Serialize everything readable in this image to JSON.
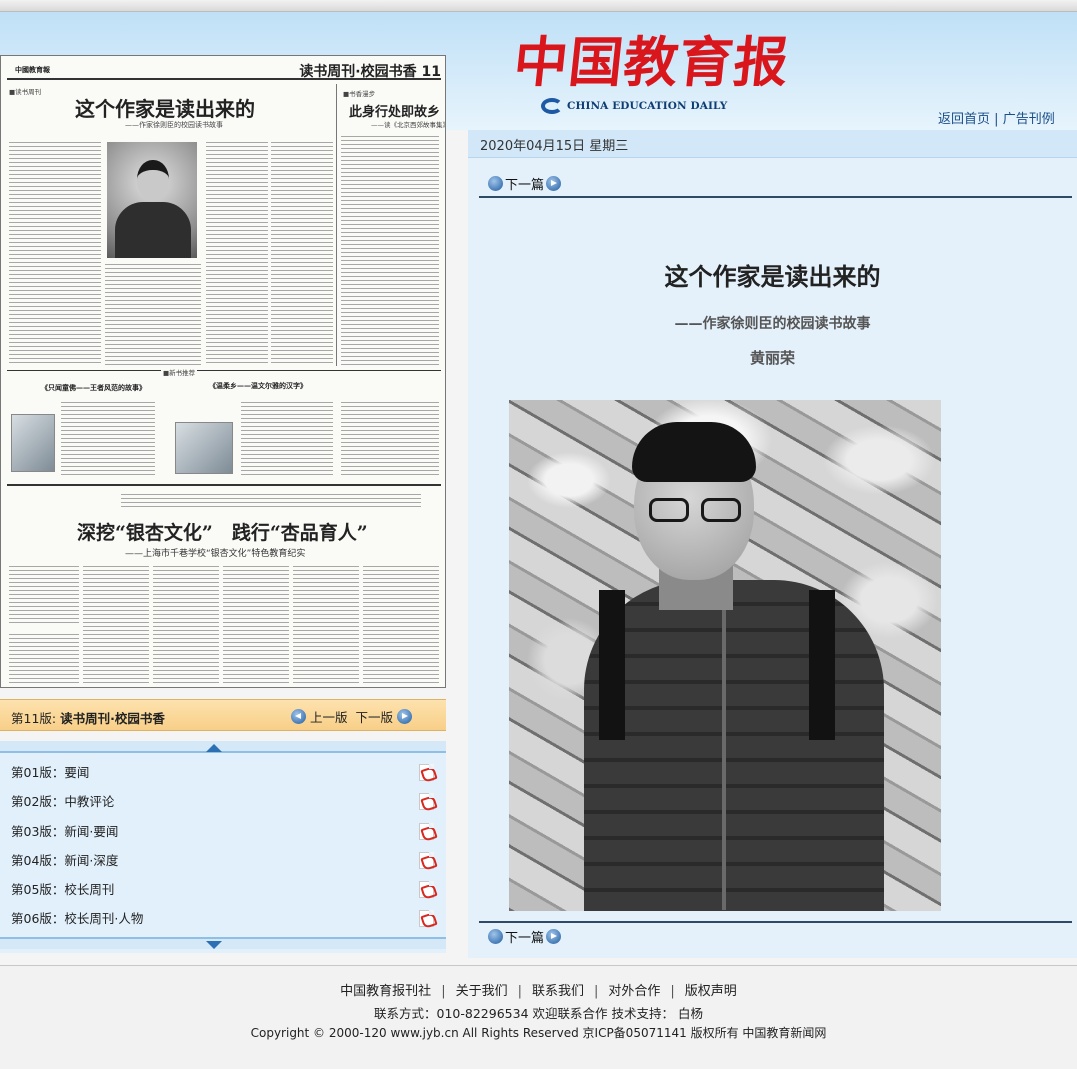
{
  "header": {
    "logo_cn": "中国教育报",
    "logo_en": "CHINA EDUCATION DAILY",
    "link_home": "返回首页",
    "link_separator": "|",
    "link_ads": "广告刊例"
  },
  "newspaper": {
    "masthead": "中國教育報",
    "section_header": "读书周刊·校园书香 11",
    "main_title": "这个作家是读出来的",
    "main_subtitle": "——作家徐则臣的校园读书故事",
    "side_title": "此身行处即故乡",
    "side_subtitle": "——读《北京西郊故事集》",
    "tag_campus": "■读书周刊",
    "tag_side": "■书香漫步",
    "tag_books": "■新书推荐",
    "book1_title": "《只闻童佛——王者风范的故事》",
    "book2_title": "《温柔乡——温文尔雅的汉字》",
    "second_title": "深挖“银杏文化”　践行“杏品育人”",
    "second_subtitle": "——上海市千巷学校“银杏文化”特色教育纪实"
  },
  "edition_bar": {
    "prefix": "第11版:",
    "name": "读书周刊·校园书香",
    "prev": "上一版",
    "next": "下一版"
  },
  "editions": [
    {
      "label": "第01版：要闻"
    },
    {
      "label": "第02版：中教评论"
    },
    {
      "label": "第03版：新闻·要闻"
    },
    {
      "label": "第04版：新闻·深度"
    },
    {
      "label": "第05版：校长周刊"
    },
    {
      "label": "第06版：校长周刊·人物"
    }
  ],
  "article": {
    "date": "2020年04月15日 星期三",
    "next_article": "下一篇",
    "title": "这个作家是读出来的",
    "subtitle": "——作家徐则臣的校园读书故事",
    "author": "黄丽荣"
  },
  "footer": {
    "links": [
      "中国教育报刊社",
      "关于我们",
      "联系我们",
      "对外合作",
      "版权声明"
    ],
    "separator": "|",
    "contact": "联系方式：010-82296534 欢迎联系合作 技术支持： 白杨",
    "copyright": "Copyright © 2000-120 www.jyb.cn All Rights Reserved 京ICP备05071141 版权所有 中国教育新闻网"
  }
}
